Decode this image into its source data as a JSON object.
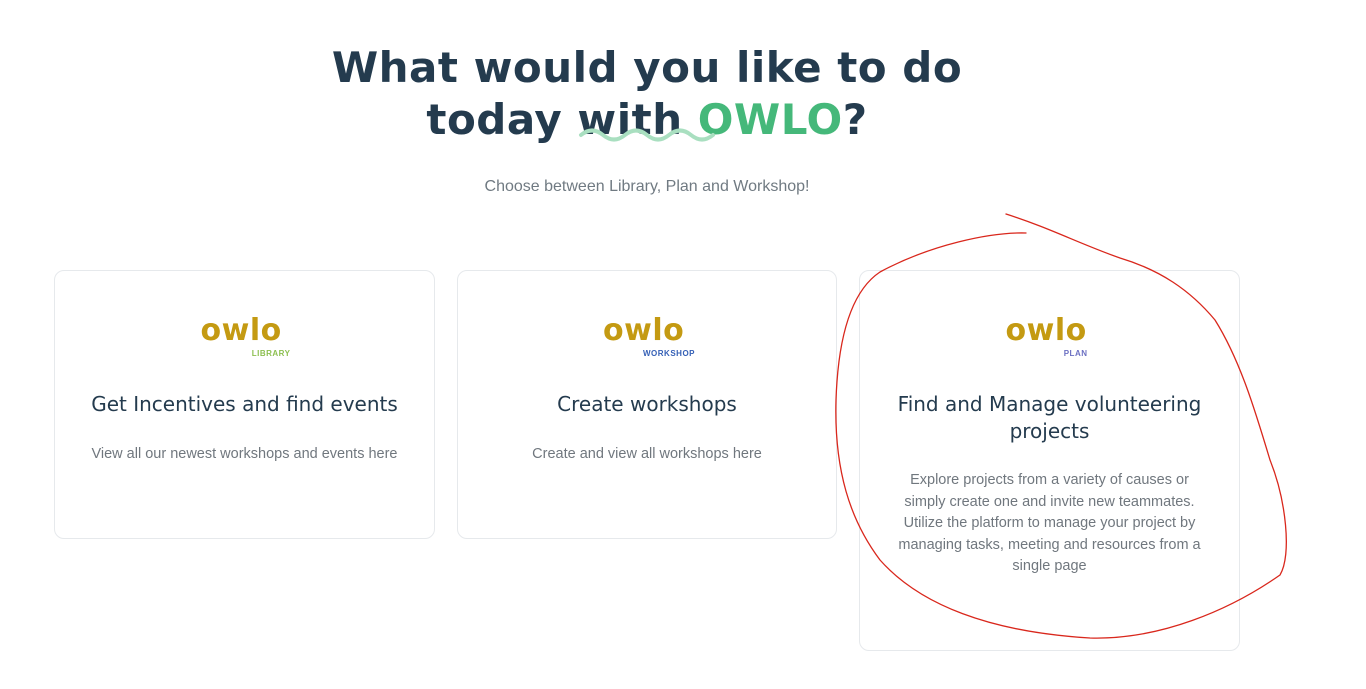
{
  "header": {
    "title_line1": "What would you like to do",
    "title_line2_prefix": "today with ",
    "title_brand": "OWLO",
    "title_suffix": "?",
    "subtitle": "Choose between Library, Plan and Workshop!"
  },
  "colors": {
    "heading": "#243b4e",
    "brand_green": "#45b87a",
    "logo_gold": "#c49a12",
    "library_green": "#8cbf4f",
    "workshop_blue": "#3560b6",
    "plan_purple": "#6b6fc2",
    "annotation_red": "#d9271c"
  },
  "cards": [
    {
      "logo_text": "owlo",
      "logo_sub": "LIBRARY",
      "title": "Get Incentives and find events",
      "description": "View all our newest workshops and events here"
    },
    {
      "logo_text": "owlo",
      "logo_sub": "WORKSHOP",
      "title": "Create workshops",
      "description": "Create and view all workshops here"
    },
    {
      "logo_text": "owlo",
      "logo_sub": "PLAN",
      "title": "Find and Manage volunteering projects",
      "description": "Explore projects from a variety of causes or simply create one and invite new teammates. Utilize the platform to manage your project by managing tasks, meeting and resources from a single page"
    }
  ]
}
